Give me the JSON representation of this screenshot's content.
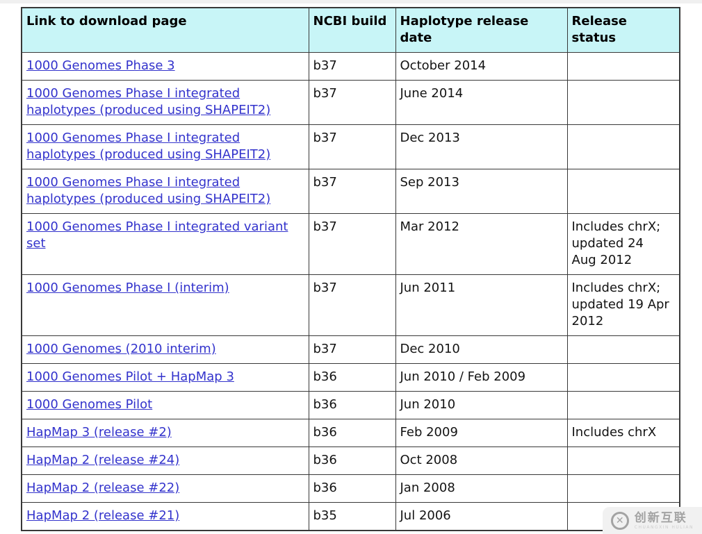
{
  "table": {
    "header_bg": "#c8f5f7",
    "border_color": "#383838",
    "link_color": "#3333cc",
    "columns": [
      "Link to download page",
      "NCBI build",
      "Haplotype release date",
      "Release status"
    ],
    "rows": [
      {
        "link": "1000 Genomes Phase 3",
        "build": "b37",
        "date": "October 2014",
        "status": ""
      },
      {
        "link": "1000 Genomes Phase I integrated haplotypes (produced using SHAPEIT2)",
        "build": "b37",
        "date": "June 2014",
        "status": ""
      },
      {
        "link": "1000 Genomes Phase I integrated haplotypes (produced using SHAPEIT2)",
        "build": "b37",
        "date": "Dec 2013",
        "status": ""
      },
      {
        "link": "1000 Genomes Phase I integrated haplotypes (produced using SHAPEIT2)",
        "build": "b37",
        "date": "Sep 2013",
        "status": ""
      },
      {
        "link": "1000 Genomes Phase I integrated variant set",
        "build": "b37",
        "date": "Mar 2012",
        "status": "Includes chrX;\nupdated 24\nAug 2012"
      },
      {
        "link": "1000 Genomes Phase I (interim)",
        "build": "b37",
        "date": "Jun 2011",
        "status": "Includes chrX;\nupdated 19 Apr\n2012"
      },
      {
        "link": "1000 Genomes (2010 interim)",
        "build": "b37",
        "date": "Dec 2010",
        "status": ""
      },
      {
        "link": "1000 Genomes Pilot + HapMap 3",
        "build": "b36",
        "date": "Jun 2010 / Feb 2009",
        "status": ""
      },
      {
        "link": "1000 Genomes Pilot",
        "build": "b36",
        "date": "Jun 2010",
        "status": ""
      },
      {
        "link": "HapMap 3 (release #2)",
        "build": "b36",
        "date": "Feb 2009",
        "status": "Includes chrX"
      },
      {
        "link": "HapMap 2 (release #24)",
        "build": "b36",
        "date": "Oct 2008",
        "status": ""
      },
      {
        "link": "HapMap 2 (release #22)",
        "build": "b36",
        "date": "Jan 2008",
        "status": ""
      },
      {
        "link": "HapMap 2 (release #21)",
        "build": "b35",
        "date": "Jul 2006",
        "status": ""
      }
    ]
  },
  "watermark": {
    "logo": "✕",
    "text": "创新互联",
    "subtext": "CHUANGXIN HULIAN"
  }
}
